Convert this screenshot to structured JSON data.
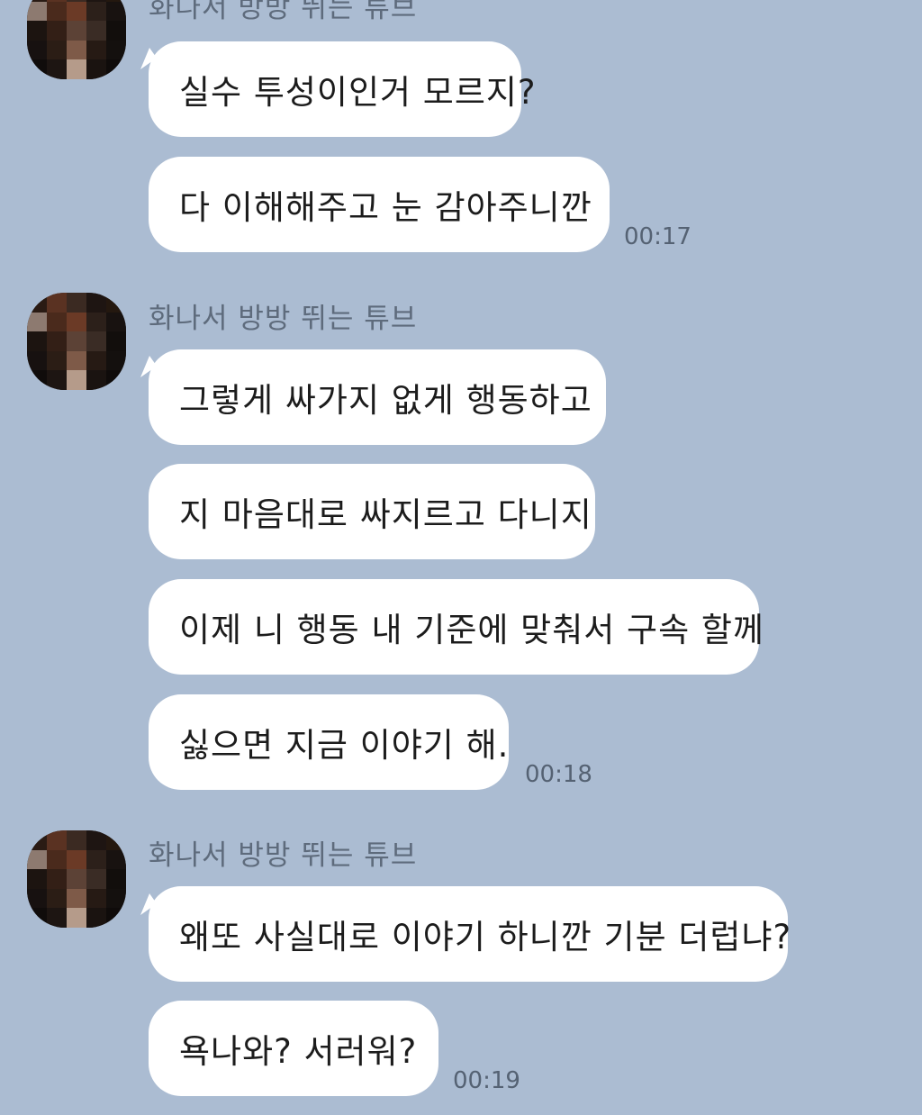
{
  "groups": [
    {
      "sender": "화나서 방방 뛰는 튜브",
      "messages": [
        "실수 투성이인거 모르지?",
        "다 이해해주고 눈 감아주니깐"
      ],
      "time": "00:17"
    },
    {
      "sender": "화나서 방방 뛰는 튜브",
      "messages": [
        "그렇게 싸가지 없게 행동하고",
        "지 마음대로 싸지르고 다니지",
        "이제 니 행동 내 기준에 맞춰서 구속 할께",
        "싫으면 지금 이야기 해."
      ],
      "time": "00:18"
    },
    {
      "sender": "화나서 방방 뛰는 튜브",
      "messages": [
        "왜또 사실대로 이야기 하니깐 기분 더럽냐?",
        "욕나와? 서러워?"
      ],
      "time": "00:19"
    }
  ],
  "colors": {
    "background": "#abbcd2",
    "bubble": "#ffffff",
    "sender_name": "#5e6b7c",
    "timestamp": "#556273"
  }
}
